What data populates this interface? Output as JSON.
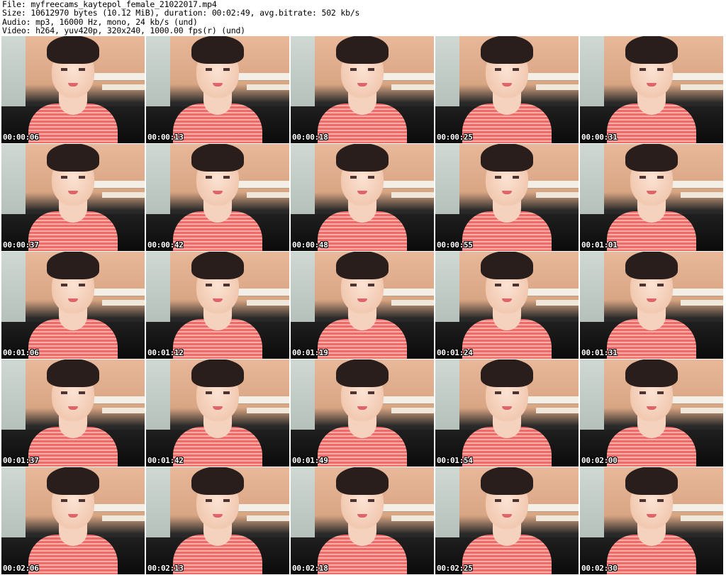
{
  "header": {
    "file_line": "File: myfreecams_kaytepol_female_21022017.mp4",
    "size_line": "Size: 10612970 bytes (10.12 MiB), duration: 00:02:49, avg.bitrate: 502 kb/s",
    "audio_line": "Audio: mp3, 16000 Hz, mono, 24 kb/s (und)",
    "video_line": "Video: h264, yuv420p, 320x240, 1000.00 fps(r) (und)"
  },
  "thumbnails": [
    {
      "timestamp": "00:00:06"
    },
    {
      "timestamp": "00:00:13"
    },
    {
      "timestamp": "00:00:18"
    },
    {
      "timestamp": "00:00:25"
    },
    {
      "timestamp": "00:00:31"
    },
    {
      "timestamp": "00:00:37"
    },
    {
      "timestamp": "00:00:42"
    },
    {
      "timestamp": "00:00:48"
    },
    {
      "timestamp": "00:00:55"
    },
    {
      "timestamp": "00:01:01"
    },
    {
      "timestamp": "00:01:06"
    },
    {
      "timestamp": "00:01:12"
    },
    {
      "timestamp": "00:01:19"
    },
    {
      "timestamp": "00:01:24"
    },
    {
      "timestamp": "00:01:31"
    },
    {
      "timestamp": "00:01:37"
    },
    {
      "timestamp": "00:01:42"
    },
    {
      "timestamp": "00:01:49"
    },
    {
      "timestamp": "00:01:54"
    },
    {
      "timestamp": "00:02:00"
    },
    {
      "timestamp": "00:02:06"
    },
    {
      "timestamp": "00:02:13"
    },
    {
      "timestamp": "00:02:18"
    },
    {
      "timestamp": "00:02:25"
    },
    {
      "timestamp": "00:02:30"
    }
  ]
}
